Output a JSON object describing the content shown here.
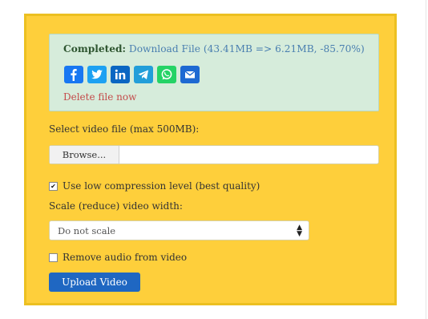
{
  "result": {
    "completed_label": "Completed:",
    "download_text": "Download File (43.41MB => 6.21MB, -85.70%)",
    "delete_text": "Delete file now",
    "share_icons": [
      "facebook-icon",
      "twitter-icon",
      "linkedin-icon",
      "telegram-icon",
      "whatsapp-icon",
      "email-icon"
    ]
  },
  "form": {
    "select_file_label": "Select video file (max 500MB):",
    "browse_label": "Browse...",
    "low_compression_label": "Use low compression level (best quality)",
    "low_compression_checked": true,
    "scale_label": "Scale (reduce) video width:",
    "scale_selected": "Do not scale",
    "remove_audio_label": "Remove audio from video",
    "remove_audio_checked": false,
    "upload_label": "Upload Video"
  },
  "colors": {
    "panel_bg": "#fecf3b",
    "result_bg": "#d6ecdb",
    "button_bg": "#1f67c2",
    "link": "#4a7fb0",
    "delete": "#c44a4a"
  }
}
